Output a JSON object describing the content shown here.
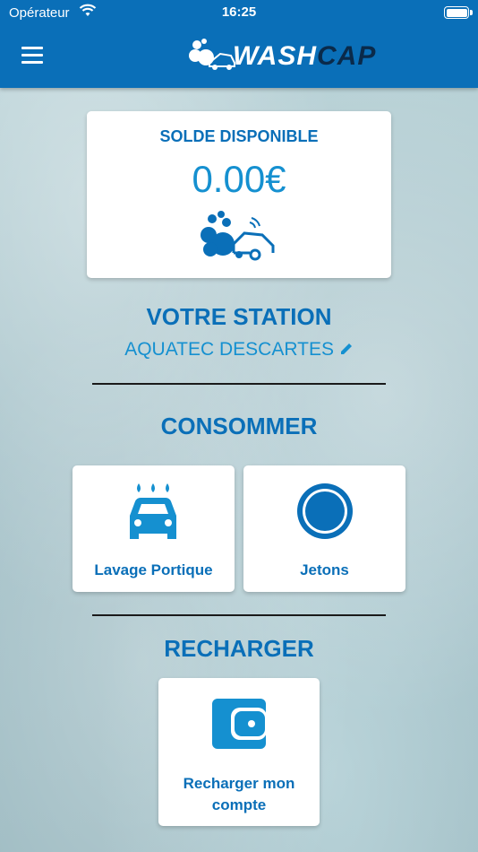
{
  "status_bar": {
    "carrier": "Opérateur",
    "time": "16:25"
  },
  "header": {
    "logo_wash": "WASH",
    "logo_cap": "CAP",
    "menu_icon": "hamburger-menu-icon",
    "brand_color": "#0a6fb8"
  },
  "balance": {
    "title": "SOLDE DISPONIBLE",
    "value": "0.00€",
    "icon": "car-wash-bubbles-icon"
  },
  "station": {
    "heading": "VOTRE STATION",
    "name": "AQUATEC DESCARTES",
    "edit_icon": "pencil-icon"
  },
  "consume": {
    "heading": "CONSOMMER",
    "tiles": [
      {
        "label": "Lavage Portique",
        "icon": "car-wash-portal-icon"
      },
      {
        "label": "Jetons",
        "icon": "token-coin-icon"
      }
    ]
  },
  "recharge": {
    "heading": "RECHARGER",
    "tile": {
      "label": "Recharger mon compte",
      "icon": "wallet-icon"
    }
  }
}
